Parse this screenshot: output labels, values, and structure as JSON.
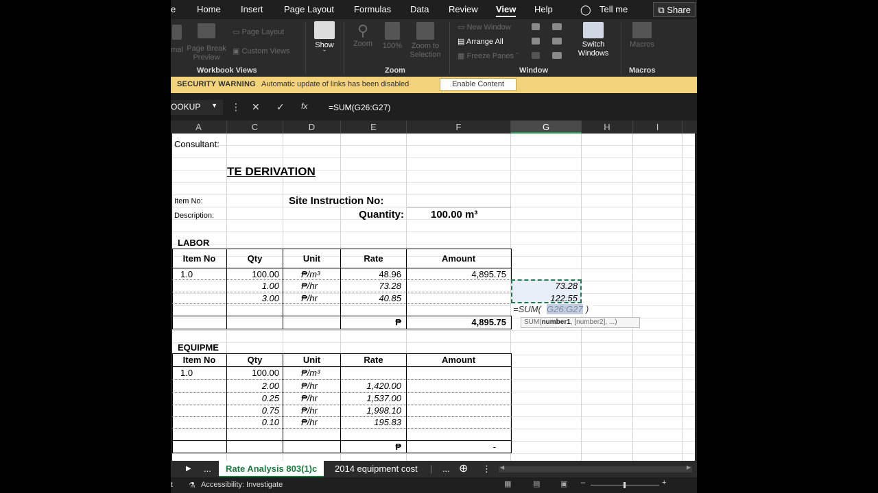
{
  "menu": {
    "file_stub": "e",
    "items": [
      "Home",
      "Insert",
      "Page Layout",
      "Formulas",
      "Data",
      "Review",
      "View",
      "Help"
    ],
    "active": "View",
    "tell_me": "Tell me",
    "share": "Share"
  },
  "ribbon": {
    "normal_stub": "mal",
    "page_break_preview": "Page Break Preview",
    "page_layout": "Page Layout",
    "custom_views": "Custom Views",
    "show": "Show",
    "zoom": "Zoom",
    "zoom_100": "100%",
    "zoom_to_selection": "Zoom to Selection",
    "new_window": "New Window",
    "arrange_all": "Arrange All",
    "freeze_panes": "Freeze Panes",
    "switch_windows": "Switch Windows",
    "macros": "Macros",
    "groups": {
      "workbook_views": "Workbook Views",
      "zoom": "Zoom",
      "window": "Window",
      "macros": "Macros"
    }
  },
  "security_bar": {
    "title": "SECURITY WARNING",
    "message": "Automatic update of links has been disabled",
    "button": "Enable Content"
  },
  "formula_bar": {
    "name_box": "OOKUP",
    "formula": "=SUM(G26:G27)"
  },
  "columns": [
    "A",
    "C",
    "D",
    "E",
    "F",
    "G",
    "H",
    "I"
  ],
  "selected_column": "G",
  "sheet": {
    "consultant": "Consultant:",
    "title": "TE DERIVATION",
    "item_no_label": "Item No:",
    "description_label": "Description:",
    "site_instruction": "Site Instruction No:",
    "quantity_label": "Quantity:",
    "quantity_value": "100.00 m³",
    "labor_header": "LABOR",
    "equipment_header": "EQUIPME",
    "table_headers": [
      "Item No",
      "Qty",
      "Unit",
      "Rate",
      "Amount"
    ],
    "labor_rows": [
      {
        "item": "1.0",
        "qty": "100.00",
        "unit": "₱/m³",
        "rate": "48.96",
        "amount": "4,895.75"
      },
      {
        "item": "",
        "qty": "1.00",
        "unit": "₱/hr",
        "rate": "73.28",
        "amount": ""
      },
      {
        "item": "",
        "qty": "3.00",
        "unit": "₱/hr",
        "rate": "40.85",
        "amount": ""
      }
    ],
    "labor_total_currency": "₱",
    "labor_total": "4,895.75",
    "g_values": [
      "73.28",
      "122.55"
    ],
    "editing_formula_prefix": "=SUM(",
    "editing_formula_ref": "G26:G27",
    "editing_formula_suffix": ")",
    "tooltip_fn": "SUM(",
    "tooltip_arg1": "number1",
    "tooltip_rest": ", [number2], ...)",
    "equipment_rows": [
      {
        "item": "1.0",
        "qty": "100.00",
        "unit": "₱/m³",
        "rate": ""
      },
      {
        "item": "",
        "qty": "2.00",
        "unit": "₱/hr",
        "rate": "1,420.00"
      },
      {
        "item": "",
        "qty": "0.25",
        "unit": "₱/hr",
        "rate": "1,537.00"
      },
      {
        "item": "",
        "qty": "0.75",
        "unit": "₱/hr",
        "rate": "1,998.10"
      },
      {
        "item": "",
        "qty": "0.10",
        "unit": "₱/hr",
        "rate": "195.83"
      }
    ],
    "equipment_total_currency": "₱",
    "equipment_total": "-"
  },
  "tabs": {
    "ellipsis": "...",
    "active": "Rate Analysis 803(1)c",
    "other": "2014 equipment cost",
    "ellipsis2": "..."
  },
  "status": {
    "mode_stub": "t",
    "accessibility": "Accessibility: Investigate"
  },
  "colors": {
    "accent_green": "#1a7a3c",
    "security_yellow": "#f2d27a"
  }
}
